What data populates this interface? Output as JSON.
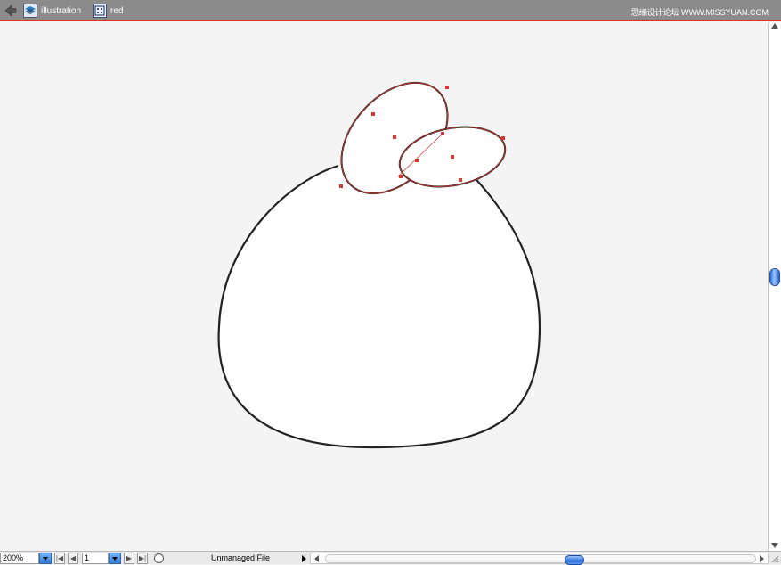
{
  "breadcrumb": {
    "items": [
      {
        "label": "illustration",
        "icon": "layer-icon"
      },
      {
        "label": "red",
        "icon": "symbol-icon"
      }
    ]
  },
  "watermark": "思缘设计论坛 WWW.MISSYUAN.COM",
  "status_bar": {
    "zoom_value": "200%",
    "page_value": "1",
    "status_text": "Unmanaged File"
  },
  "colors": {
    "topbar": "#8b8b8b",
    "selection": "#d9362f",
    "canvas": "#f4f4f4",
    "stroke": "#222222"
  }
}
